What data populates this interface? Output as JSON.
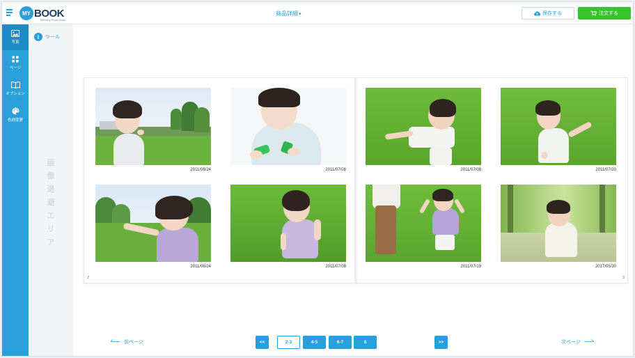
{
  "header": {
    "logo_my": "MY",
    "logo_book": "BOOK",
    "logo_sub": "Memory Photo Book",
    "product_details": "商品詳細",
    "caret": "▾",
    "save_label": "保存する",
    "order_label": "注文する"
  },
  "rail": {
    "items": [
      {
        "label": "写真",
        "icon": "image-icon"
      },
      {
        "label": "ページ",
        "icon": "grid-icon"
      },
      {
        "label": "オプション",
        "icon": "book-icon"
      },
      {
        "label": "色柄変更",
        "icon": "palette-icon"
      }
    ]
  },
  "tool": {
    "label": "ツール",
    "dot": "i",
    "drop_area": [
      "画",
      "像",
      "退",
      "避",
      "エ",
      "リ",
      "ア"
    ]
  },
  "spread": {
    "left_page_num": "2",
    "right_page_num": "3",
    "photos": [
      {
        "date": "2011/06/24"
      },
      {
        "date": "2011/07/08"
      },
      {
        "date": "2011/07/08"
      },
      {
        "date": "2011/07/20"
      },
      {
        "date": "2011/06/24"
      },
      {
        "date": "2011/07/08"
      },
      {
        "date": "2011/07/19"
      },
      {
        "date": "2017/05/30"
      }
    ]
  },
  "pagination": {
    "prev_label": "前ページ",
    "next_label": "次ページ",
    "first": "<<",
    "last": ">>",
    "pages": [
      "2-3",
      "4-5",
      "6-7",
      "8"
    ],
    "current": "2-3"
  },
  "colors": {
    "accent": "#29a0d8",
    "order_green": "#38c22d",
    "logo_navy": "#1d3d63"
  }
}
